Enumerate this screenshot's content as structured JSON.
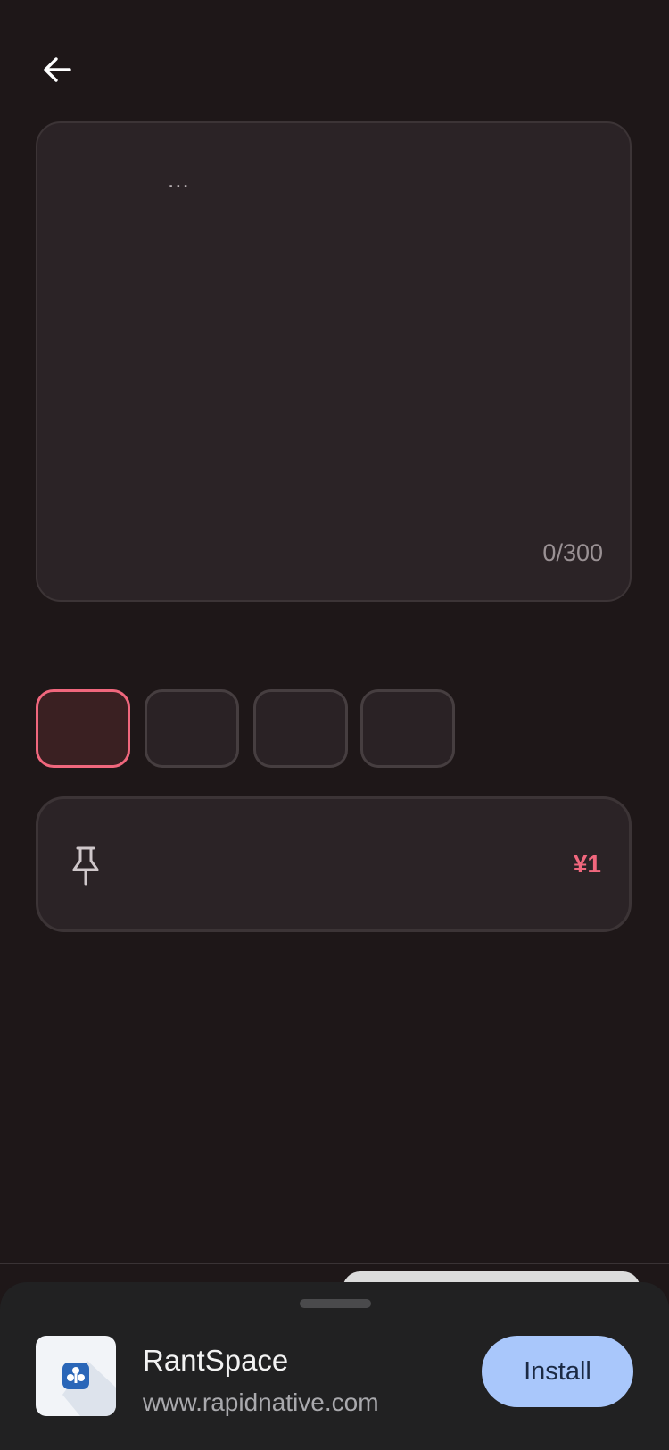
{
  "header": {
    "back_icon": "arrow-left-icon"
  },
  "editor": {
    "placeholder": "...",
    "char_count": "0/300"
  },
  "color_options": [
    {
      "color": "#3a2022",
      "selected": true
    },
    {
      "color": "#2a2225",
      "selected": false
    },
    {
      "color": "#2a2225",
      "selected": false
    },
    {
      "color": "#2a2225",
      "selected": false
    }
  ],
  "pin_option": {
    "icon": "pin-icon",
    "price": "¥1"
  },
  "install_banner": {
    "app_name": "RantSpace",
    "url": "www.rapidnative.com",
    "install_label": "Install",
    "app_icon": "rantspace-app-icon"
  },
  "colors": {
    "background": "#1e1718",
    "accent": "#f0677d",
    "install_button": "#a9c7fb"
  }
}
